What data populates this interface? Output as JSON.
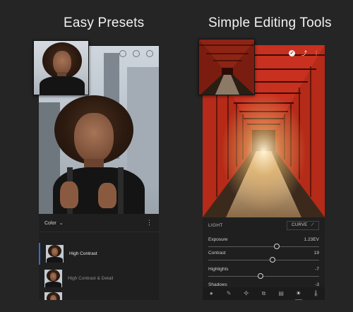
{
  "captions": {
    "left": "Easy Presets",
    "right": "Simple Editing Tools"
  },
  "left_phone": {
    "filter_group": "Color",
    "presets": [
      {
        "label": "High Contrast",
        "selected": true
      },
      {
        "label": "High Contrast & Detail",
        "selected": false
      }
    ]
  },
  "right_phone": {
    "panel_title": "LIGHT",
    "curve_button": "CURVE",
    "sliders": [
      {
        "name": "Exposure",
        "value": "1.23EV",
        "level": 0.62
      },
      {
        "name": "Contrast",
        "value": "19",
        "level": 0.58
      },
      {
        "name": "Highlights",
        "value": "-7",
        "level": 0.47
      },
      {
        "name": "Shadows",
        "value": "-3"
      }
    ],
    "toolbar_icons": [
      "profile-icon",
      "brush-icon",
      "healing-icon",
      "crop-icon",
      "presets-icon",
      "light-icon",
      "color-icon"
    ],
    "active_tool": "light-icon"
  },
  "colors": {
    "accent": "#2d6fd6",
    "background": "#252525",
    "torii_red": "#c8301f"
  }
}
